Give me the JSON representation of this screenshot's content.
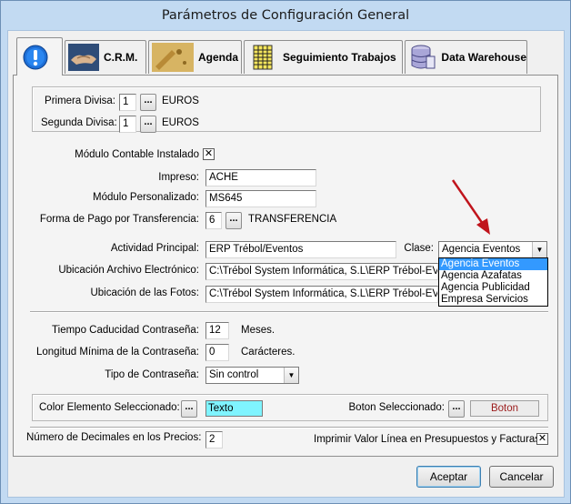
{
  "window": {
    "title": "Parámetros de Configuración General"
  },
  "tabs": [
    {
      "label": "",
      "icon": "info-icon"
    },
    {
      "label": "C.R.M.",
      "icon": "handshake-icon"
    },
    {
      "label": "Agenda",
      "icon": "agenda-icon"
    },
    {
      "label": "Seguimiento Trabajos",
      "icon": "spreadsheet-icon"
    },
    {
      "label": "Data Warehouse",
      "icon": "database-icon"
    }
  ],
  "currency": {
    "primary_label": "Primera Divisa:",
    "primary_value": "1",
    "primary_name": "EUROS",
    "secondary_label": "Segunda Divisa:",
    "secondary_value": "1",
    "secondary_name": "EUROS",
    "lookup_label": "..."
  },
  "accounting": {
    "module_label": "Módulo Contable Instalado",
    "module_checked": true,
    "printed_label": "Impreso:",
    "printed_value": "ACHE",
    "custom_label": "Módulo Personalizado:",
    "custom_value": "MS645",
    "payment_label": "Forma de Pago por Transferencia:",
    "payment_value": "6",
    "payment_name": "TRANSFERENCIA"
  },
  "activity": {
    "main_label": "Actividad Principal:",
    "main_value": "ERP Trébol/Eventos",
    "class_label": "Clase:",
    "class_value": "Agencia Eventos",
    "class_options": [
      "Agencia Eventos",
      "Agencia Azafatas",
      "Agencia Publicidad",
      "Empresa Servicios"
    ],
    "electronic_label": "Ubicación Archivo Electrónico:",
    "electronic_value": "C:\\Trébol System Informática, S.L\\ERP Trébol-EVENTOS",
    "photos_label": "Ubicación de las Fotos:",
    "photos_value": "C:\\Trébol System Informática, S.L\\ERP Trébol-EVENTOS"
  },
  "password": {
    "expiry_label": "Tiempo Caducidad Contraseña:",
    "expiry_value": "12",
    "expiry_unit": "Meses.",
    "min_label": "Longitud Mínima de la Contraseña:",
    "min_value": "0",
    "min_unit": "Carácteres.",
    "type_label": "Tipo de Contraseña:",
    "type_value": "Sin control"
  },
  "colors": {
    "selected_label": "Color Elemento Seleccionado:",
    "selected_sample": "Texto",
    "button_label": "Boton Seleccionado:",
    "button_sample": "Boton",
    "sample_bg": "#7ff4ff"
  },
  "prices": {
    "decimals_label": "Número de Decimales en los Precios:",
    "decimals_value": "2",
    "print_line_label": "Imprimir Valor Línea en Presupuestos y Facturas",
    "print_line_checked": true
  },
  "footer": {
    "accept_label": "Aceptar",
    "cancel_label": "Cancelar"
  },
  "accent": {
    "selection": "#3399ff",
    "annotation_arrow": "#c0141c"
  }
}
